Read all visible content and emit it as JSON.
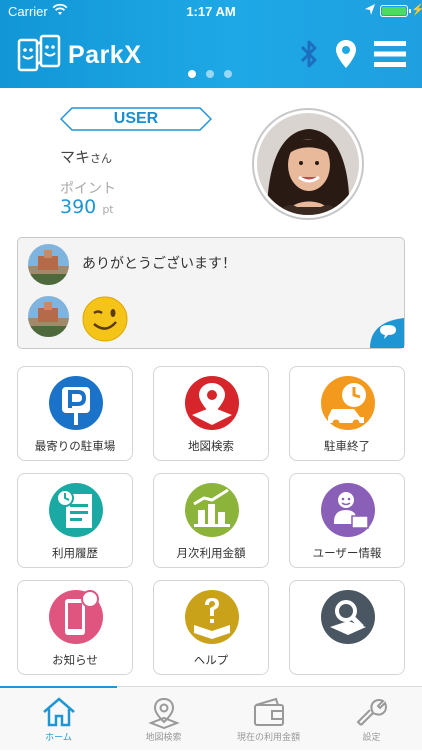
{
  "status_bar": {
    "carrier": "Carrier",
    "time": "1:17 AM"
  },
  "header": {
    "brand": "ParkX",
    "page_index": 1,
    "page_count": 3
  },
  "profile": {
    "badge": "USER",
    "name": "マキ",
    "honorific": "さん",
    "points_label": "ポイント",
    "points_value": "390",
    "points_unit": "pt"
  },
  "chat": {
    "message": "ありがとうございます！"
  },
  "menu": [
    {
      "label": "最寄りの駐車場",
      "icon": "parking-icon"
    },
    {
      "label": "地図検索",
      "icon": "map-pin-icon"
    },
    {
      "label": "駐車終了",
      "icon": "car-timer-icon"
    },
    {
      "label": "利用履歴",
      "icon": "history-icon"
    },
    {
      "label": "月次利用金額",
      "icon": "monthly-chart-icon"
    },
    {
      "label": "ユーザー情報",
      "icon": "user-info-icon"
    },
    {
      "label": "お知らせ",
      "icon": "notification-phone-icon"
    },
    {
      "label": "ヘルプ",
      "icon": "help-book-icon"
    },
    {
      "label": "",
      "icon": "search-map-icon"
    }
  ],
  "tabs": [
    {
      "label": "ホーム",
      "icon": "home-icon",
      "active": true
    },
    {
      "label": "地図検索",
      "icon": "map-pin-icon",
      "active": false
    },
    {
      "label": "現在の利用金額",
      "icon": "wallet-icon",
      "active": false
    },
    {
      "label": "設定",
      "icon": "wrench-icon",
      "active": false
    }
  ],
  "colors": {
    "header": "#1ea8e6",
    "accent": "#1e96d3",
    "parking": "#1a73c8",
    "map": "#d6262b",
    "end": "#f39a1e",
    "history": "#1aa9a3",
    "monthly": "#8cb43a",
    "user": "#8a5fb8",
    "notice": "#e0557f",
    "help": "#c9a21a",
    "search": "#4a5661"
  }
}
